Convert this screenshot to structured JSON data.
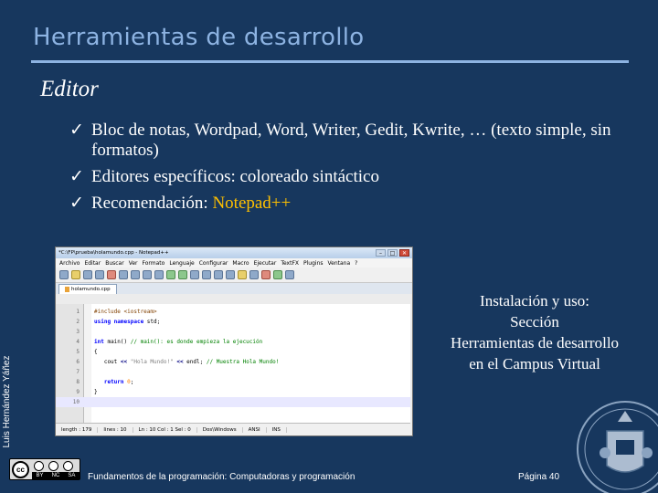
{
  "slide": {
    "title": "Herramientas de desarrollo",
    "subtitle": "Editor",
    "bullets": [
      {
        "check": "ü",
        "text": "Bloc de notas, Wordpad, Word, Writer, Gedit, Kwrite, … (texto simple, sin formatos)"
      },
      {
        "check": "ü",
        "text": "Editores específicos: coloreado sintáctico"
      },
      {
        "check": "ü",
        "pre": "Recomendación: ",
        "highlight": "Notepad++"
      }
    ],
    "side_label": "Luis Hernández Yáñez",
    "install": {
      "line1": "Instalación y uso:",
      "line2": "Sección",
      "line3": "Herramientas de desarrollo",
      "line4": "en el Campus Virtual"
    },
    "footer": "Fundamentos de la programación: Computadoras y programación",
    "page": "Página 40",
    "license": {
      "cc": "cc",
      "by": "BY",
      "nc": "NC",
      "sa": "SA"
    }
  },
  "notepad": {
    "title": "*C:\\FP\\prueba\\holamundo.cpp - Notepad++",
    "window_buttons": {
      "minimize": "–",
      "maximize": "□",
      "close": "✕"
    },
    "menu": [
      "Archivo",
      "Editar",
      "Buscar",
      "Ver",
      "Formato",
      "Lenguaje",
      "Configurar",
      "Macro",
      "Ejecutar",
      "TextFX",
      "Plugins",
      "Ventana",
      "?"
    ],
    "tab": "holamundo.cpp",
    "lines": [
      {
        "num": "1",
        "parts": [
          [
            "pp",
            "#include <iostream>"
          ]
        ]
      },
      {
        "num": "2",
        "parts": [
          [
            "kw",
            "using namespace"
          ],
          [
            "",
            " std;"
          ]
        ]
      },
      {
        "num": "3",
        "parts": [
          [
            "",
            ""
          ]
        ]
      },
      {
        "num": "4",
        "parts": [
          [
            "kw",
            "int"
          ],
          [
            "",
            " main() "
          ],
          [
            "cm",
            "// main(): es donde empieza la ejecución"
          ]
        ]
      },
      {
        "num": "5",
        "parts": [
          [
            "",
            "{"
          ]
        ]
      },
      {
        "num": "6",
        "parts": [
          [
            "",
            "   cout "
          ],
          [
            "op",
            "<<"
          ],
          [
            "str",
            " \"Hola Mundo!\" "
          ],
          [
            "op",
            "<<"
          ],
          [
            "",
            " endl; "
          ],
          [
            "cm",
            "// Muestra Hola Mundo!"
          ]
        ]
      },
      {
        "num": "7",
        "parts": [
          [
            "",
            ""
          ]
        ]
      },
      {
        "num": "8",
        "parts": [
          [
            "",
            "   "
          ],
          [
            "kw",
            "return"
          ],
          [
            "num-lit",
            " 0"
          ],
          [
            "",
            ";"
          ]
        ]
      },
      {
        "num": "9",
        "parts": [
          [
            "",
            "}"
          ]
        ]
      },
      {
        "num": "10",
        "parts": [
          [
            "",
            ""
          ]
        ]
      }
    ],
    "status": [
      "length : 179",
      "lines : 10",
      "Ln : 10    Col : 1    Sel : 0",
      "Dos\\Windows",
      "ANSI",
      "INS"
    ]
  }
}
